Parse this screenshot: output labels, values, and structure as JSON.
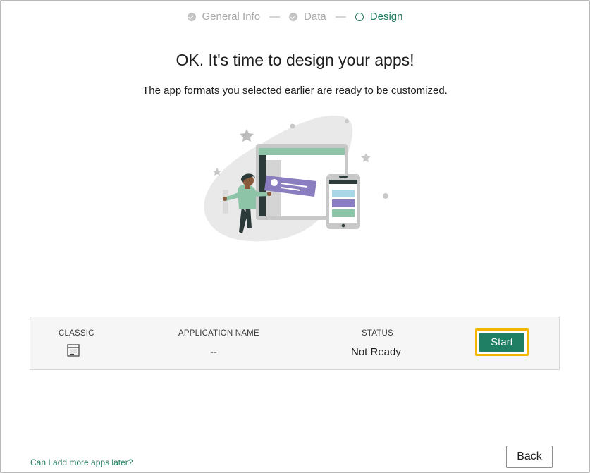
{
  "stepper": {
    "steps": [
      {
        "label": "General Info",
        "state": "done"
      },
      {
        "label": "Data",
        "state": "done"
      },
      {
        "label": "Design",
        "state": "active"
      }
    ],
    "separator": "—"
  },
  "header": {
    "title": "OK. It's time to design your apps!",
    "subtitle": "The app formats you selected earlier are ready to be customized."
  },
  "apps_table": {
    "columns": {
      "classic": "CLASSIC",
      "application_name": "APPLICATION NAME",
      "status": "STATUS"
    },
    "rows": [
      {
        "format_icon": "form-icon",
        "application_name": "--",
        "status": "Not Ready",
        "action_label": "Start"
      }
    ]
  },
  "footer": {
    "help_link": "Can I add more apps later?",
    "back_label": "Back"
  },
  "colors": {
    "accent": "#217a5f",
    "button_fill": "#1f7f64",
    "highlight": "#f5b400"
  }
}
